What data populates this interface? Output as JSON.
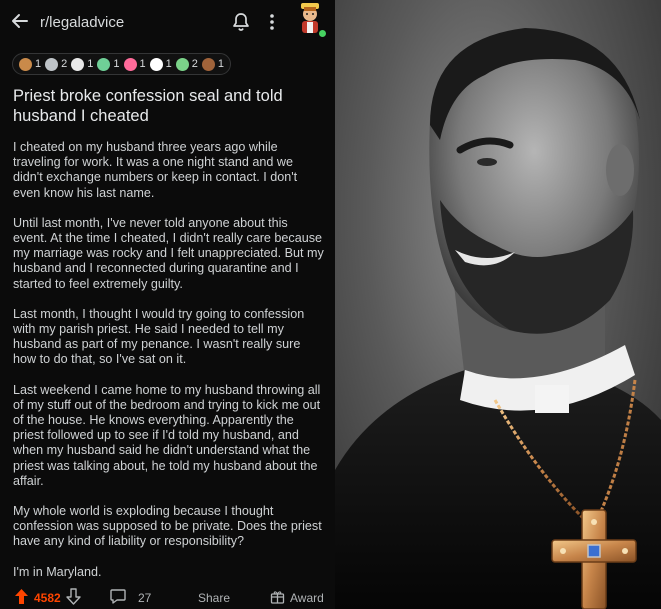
{
  "header": {
    "subreddit": "r/legaladvice",
    "back_icon": "back-arrow-icon",
    "notification_icon": "bell-icon",
    "menu_icon": "more-vertical-icon"
  },
  "awards": [
    {
      "icon": "award-wholesome-icon",
      "count": "1",
      "color": "#c98a4a"
    },
    {
      "icon": "award-silver-icon",
      "count": "2",
      "color": "#bfc4c8"
    },
    {
      "icon": "award-helpful-icon",
      "count": "1",
      "color": "#e8e8e8"
    },
    {
      "icon": "award-plant-icon",
      "count": "1",
      "color": "#6fcf97"
    },
    {
      "icon": "award-heart-icon",
      "count": "1",
      "color": "#ff6b9a"
    },
    {
      "icon": "award-page-icon",
      "count": "1",
      "color": "#ffffff"
    },
    {
      "icon": "award-seven-icon",
      "count": "2",
      "color": "#7bd389"
    },
    {
      "icon": "award-poop-icon",
      "count": "1",
      "color": "#a0633a"
    }
  ],
  "post": {
    "title": "Priest broke confession seal and told husband I cheated",
    "paragraphs": [
      "I cheated on my husband three years ago while traveling for work. It was a one night stand and we didn't exchange numbers or keep in contact. I don't even know his last name.",
      "Until last month, I've never told anyone about this event. At the time I cheated, I didn't really care because my marriage was rocky and I felt unappreciated. But my husband and I reconnected during quarantine and I started to feel extremely guilty.",
      "Last month, I thought I would try going to confession with my parish priest. He said I needed to tell my husband as part of my penance. I wasn't really sure how to do that, so I've sat on it.",
      "Last weekend I came home to my husband throwing all of my stuff out of the bedroom and trying to kick me out of the house. He knows everything. Apparently the priest followed up to see if I'd told my husband, and when my husband said he didn't understand what the priest was talking about, he told my husband about the affair.",
      "My whole world is exploding because I thought confession was supposed to be private. Does the priest have any kind of liability or responsibility?",
      "I'm in Maryland."
    ]
  },
  "actions": {
    "score": "4582",
    "comments": "27",
    "share": "Share",
    "award": "Award",
    "upvote_color": "#ff4500"
  },
  "image": {
    "description_icon": "meme-image"
  }
}
